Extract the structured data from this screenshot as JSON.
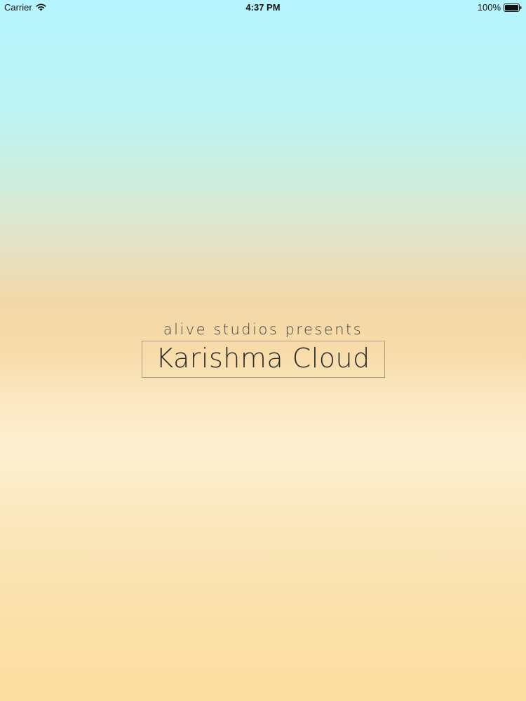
{
  "status_bar": {
    "carrier": "Carrier",
    "time": "4:37 PM",
    "battery": "100%",
    "icons": [
      "wifi-icon",
      "battery-icon"
    ]
  },
  "splash": {
    "tagline": "alive studios presents",
    "title": "Karishma Cloud"
  }
}
